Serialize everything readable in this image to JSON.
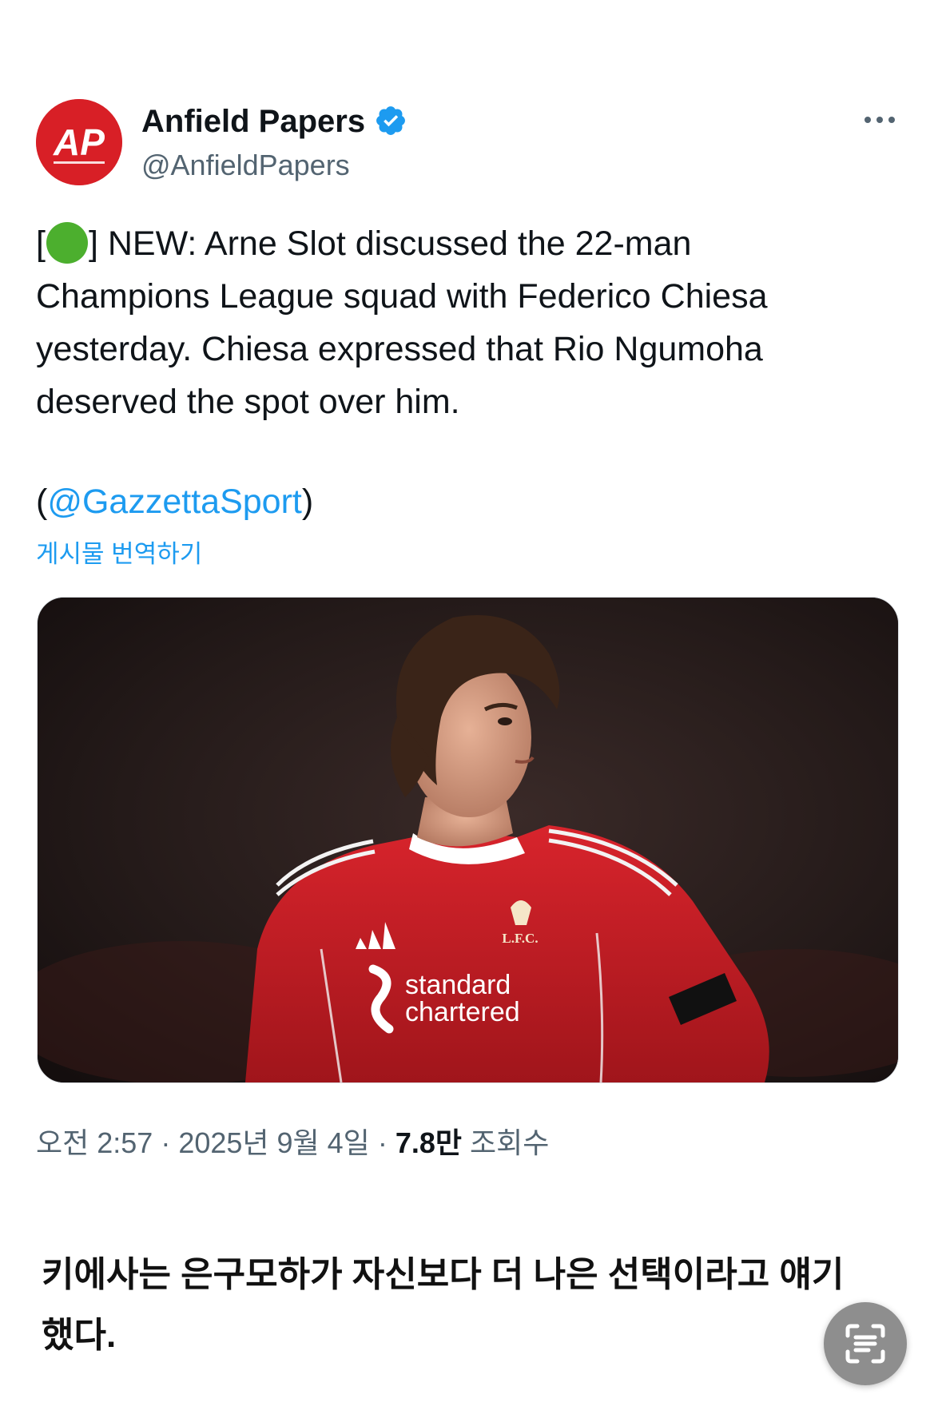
{
  "tweet": {
    "author": {
      "display_name": "Anfield Papers",
      "handle": "@AnfieldPapers",
      "avatar_text": "AP",
      "verified": true
    },
    "text": {
      "line1_open": "[",
      "line1_rest": "] NEW: Arne Slot discussed the 22-man",
      "line2": "Champions League squad with Federico Chiesa",
      "line3": "yesterday. Chiesa expressed that Rio Ngumoha",
      "line4": "deserved the spot over him."
    },
    "source": {
      "open": "(",
      "mention": "@GazzettaSport",
      "close": ")"
    },
    "translate_label": "게시물 번역하기",
    "media": {
      "sponsor_line1": "standard",
      "sponsor_line2": "chartered",
      "crest_text": "L.F.C."
    },
    "meta": {
      "time": "오전 2:57",
      "separator1": " · ",
      "date": "2025년 9월 4일",
      "separator2": " · ",
      "views_count": "7.8만",
      "views_label": "조회수"
    }
  },
  "caption": {
    "line1": "키에사는 은구모하가 자신보다 더 나은 선택이라고 얘기",
    "line2": "했다."
  },
  "colors": {
    "link": "#1d9bf0",
    "secondary_text": "#536471",
    "brand_red": "#d81f26",
    "green_dot": "#4caf2e"
  },
  "icons": {
    "verified": "verified-badge-icon",
    "more": "more-horizontal-icon",
    "scan": "text-scan-icon"
  }
}
